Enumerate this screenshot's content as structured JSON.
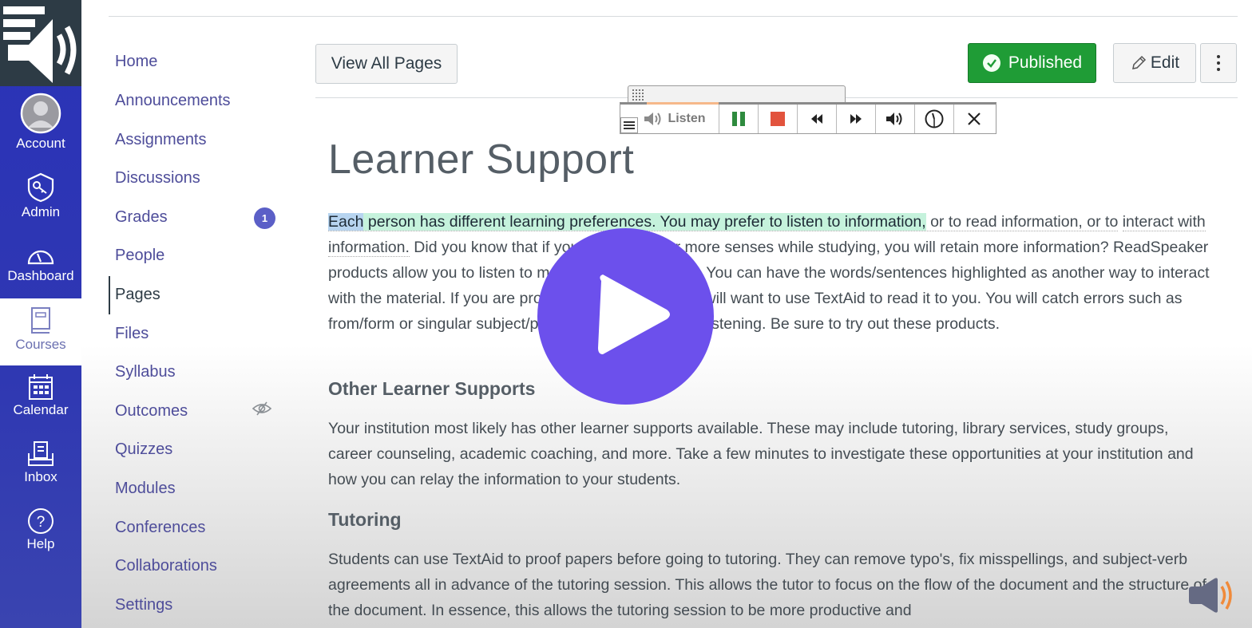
{
  "global_nav": {
    "logo": "readspeaker-logo",
    "items": [
      {
        "label": "Account",
        "icon": "user-avatar-icon"
      },
      {
        "label": "Admin",
        "icon": "shield-key-icon"
      },
      {
        "label": "Dashboard",
        "icon": "speedometer-icon"
      },
      {
        "label": "Courses",
        "icon": "book-icon",
        "active": true
      },
      {
        "label": "Calendar",
        "icon": "calendar-icon"
      },
      {
        "label": "Inbox",
        "icon": "inbox-icon"
      },
      {
        "label": "Help",
        "icon": "help-circle-icon"
      }
    ]
  },
  "course_nav": {
    "items": [
      {
        "label": "Home"
      },
      {
        "label": "Announcements"
      },
      {
        "label": "Assignments"
      },
      {
        "label": "Discussions"
      },
      {
        "label": "Grades",
        "badge": "1"
      },
      {
        "label": "People"
      },
      {
        "label": "Pages",
        "active": true
      },
      {
        "label": "Files"
      },
      {
        "label": "Syllabus"
      },
      {
        "label": "Outcomes",
        "hidden_icon": "eye-slash-icon"
      },
      {
        "label": "Quizzes"
      },
      {
        "label": "Modules"
      },
      {
        "label": "Conferences"
      },
      {
        "label": "Collaborations"
      },
      {
        "label": "Settings"
      }
    ]
  },
  "header": {
    "view_all_pages": "View All Pages",
    "published": "Published",
    "edit": "Edit"
  },
  "readspeaker": {
    "listen": "Listen",
    "buttons": [
      "pause",
      "stop",
      "rewind",
      "fast-forward",
      "volume",
      "speed",
      "close"
    ],
    "colors": {
      "pause": "#2e8b3e",
      "stop": "#e2533d",
      "progress": "#f6b88a"
    }
  },
  "page": {
    "title": "Learner Support",
    "intro": {
      "word": "Each",
      "sentence": " person has different learning preferences.  You may prefer to listen to information,",
      "rest_line1": " or to read information, or to",
      "dotted": "interact with information.",
      "rest": "  Did you know that if you employ two or more senses while studying, you will retain more information?  ReadSpeaker products allow you to listen to materials as you read it. You can have the words/sentences highlighted as another way to interact with the material.  If you are proofing a paper, then you will want to use TextAid to read it to you.  You will catch errors such as from/form or singular subject/plural verb when you are listening.  Be sure to try out these products."
    },
    "section_other": {
      "heading": "Other Learner Supports",
      "body": "Your institution most likely has other learner supports available. These may include tutoring, library services, study groups, career counseling, academic coaching, and more. Take a few minutes to investigate these opportunities at your institution and how you can relay the information to your students."
    },
    "section_tutoring": {
      "heading": "Tutoring",
      "body": "Students can use TextAid to proof papers before going to tutoring. They can remove typo's, fix misspellings, and subject-verb agreements all in advance of the tutoring session. This allows the tutor to focus on the flow of the document and the structure of the document. In essence, this allows the tutoring session to be more productive and"
    }
  },
  "colors": {
    "global_nav": "#2a32b8",
    "link": "#4e4d9a",
    "published": "#1f9c36",
    "play_button": "#6c50ec",
    "word_highlight": "#b7d4f0",
    "sentence_highlight": "#c5f2dc"
  }
}
